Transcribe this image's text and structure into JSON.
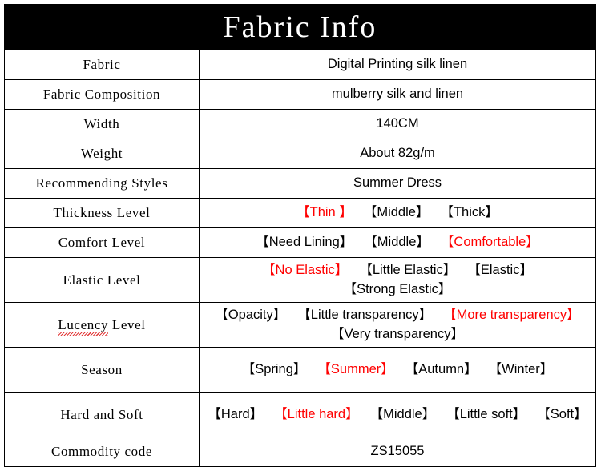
{
  "header": {
    "title": "Fabric Info"
  },
  "colors": {
    "highlight": "#ff0000",
    "text": "#000000",
    "banner_bg": "#000000",
    "banner_text": "#ffffff",
    "border": "#000000",
    "page_bg": "#ffffff"
  },
  "table": {
    "rows": [
      {
        "label": "Fabric",
        "type": "text",
        "value": "Digital Printing silk linen"
      },
      {
        "label": "Fabric Composition",
        "type": "text",
        "value": "mulberry silk and linen"
      },
      {
        "label": "Width",
        "type": "text",
        "value": "140CM"
      },
      {
        "label": "Weight",
        "type": "text",
        "value": "About 82g/m"
      },
      {
        "label": "Recommending Styles",
        "type": "text",
        "value": "Summer Dress"
      },
      {
        "label": "Thickness Level",
        "type": "options",
        "options": [
          {
            "text": "【Thin 】",
            "selected": true
          },
          {
            "text": "【Middle】",
            "selected": false
          },
          {
            "text": "【Thick】",
            "selected": false
          }
        ]
      },
      {
        "label": "Comfort Level",
        "type": "options",
        "options": [
          {
            "text": "【Need Lining】",
            "selected": false
          },
          {
            "text": "【Middle】",
            "selected": false
          },
          {
            "text": "【Comfortable】",
            "selected": true
          }
        ]
      },
      {
        "label": "Elastic Level",
        "type": "options",
        "options": [
          {
            "text": "【No Elastic】",
            "selected": true
          },
          {
            "text": "【Little Elastic】",
            "selected": false
          },
          {
            "text": "【Elastic】",
            "selected": false
          },
          {
            "text": "【Strong Elastic】",
            "selected": false
          }
        ]
      },
      {
        "label": "Lucency Level",
        "label_misspelled_word": "Lucency",
        "label_rest": " Level",
        "type": "options",
        "options": [
          {
            "text": "【Opacity】",
            "selected": false
          },
          {
            "text": "【Little transparency】",
            "selected": false
          },
          {
            "text": "【More transparency】",
            "selected": true
          },
          {
            "text": "【Very transparency】",
            "selected": false
          }
        ]
      },
      {
        "label": "Season",
        "type": "options",
        "options": [
          {
            "text": "【Spring】",
            "selected": false
          },
          {
            "text": "【Summer】",
            "selected": true
          },
          {
            "text": "【Autumn】",
            "selected": false
          },
          {
            "text": "【Winter】",
            "selected": false
          }
        ]
      },
      {
        "label": "Hard and Soft",
        "type": "options",
        "options": [
          {
            "text": "【Hard】",
            "selected": false
          },
          {
            "text": "【Little hard】",
            "selected": true
          },
          {
            "text": "【Middle】",
            "selected": false
          },
          {
            "text": "【Little soft】",
            "selected": false
          },
          {
            "text": "【Soft】",
            "selected": false
          }
        ]
      },
      {
        "label": "Commodity code",
        "type": "text",
        "value": "ZS15055"
      }
    ]
  }
}
